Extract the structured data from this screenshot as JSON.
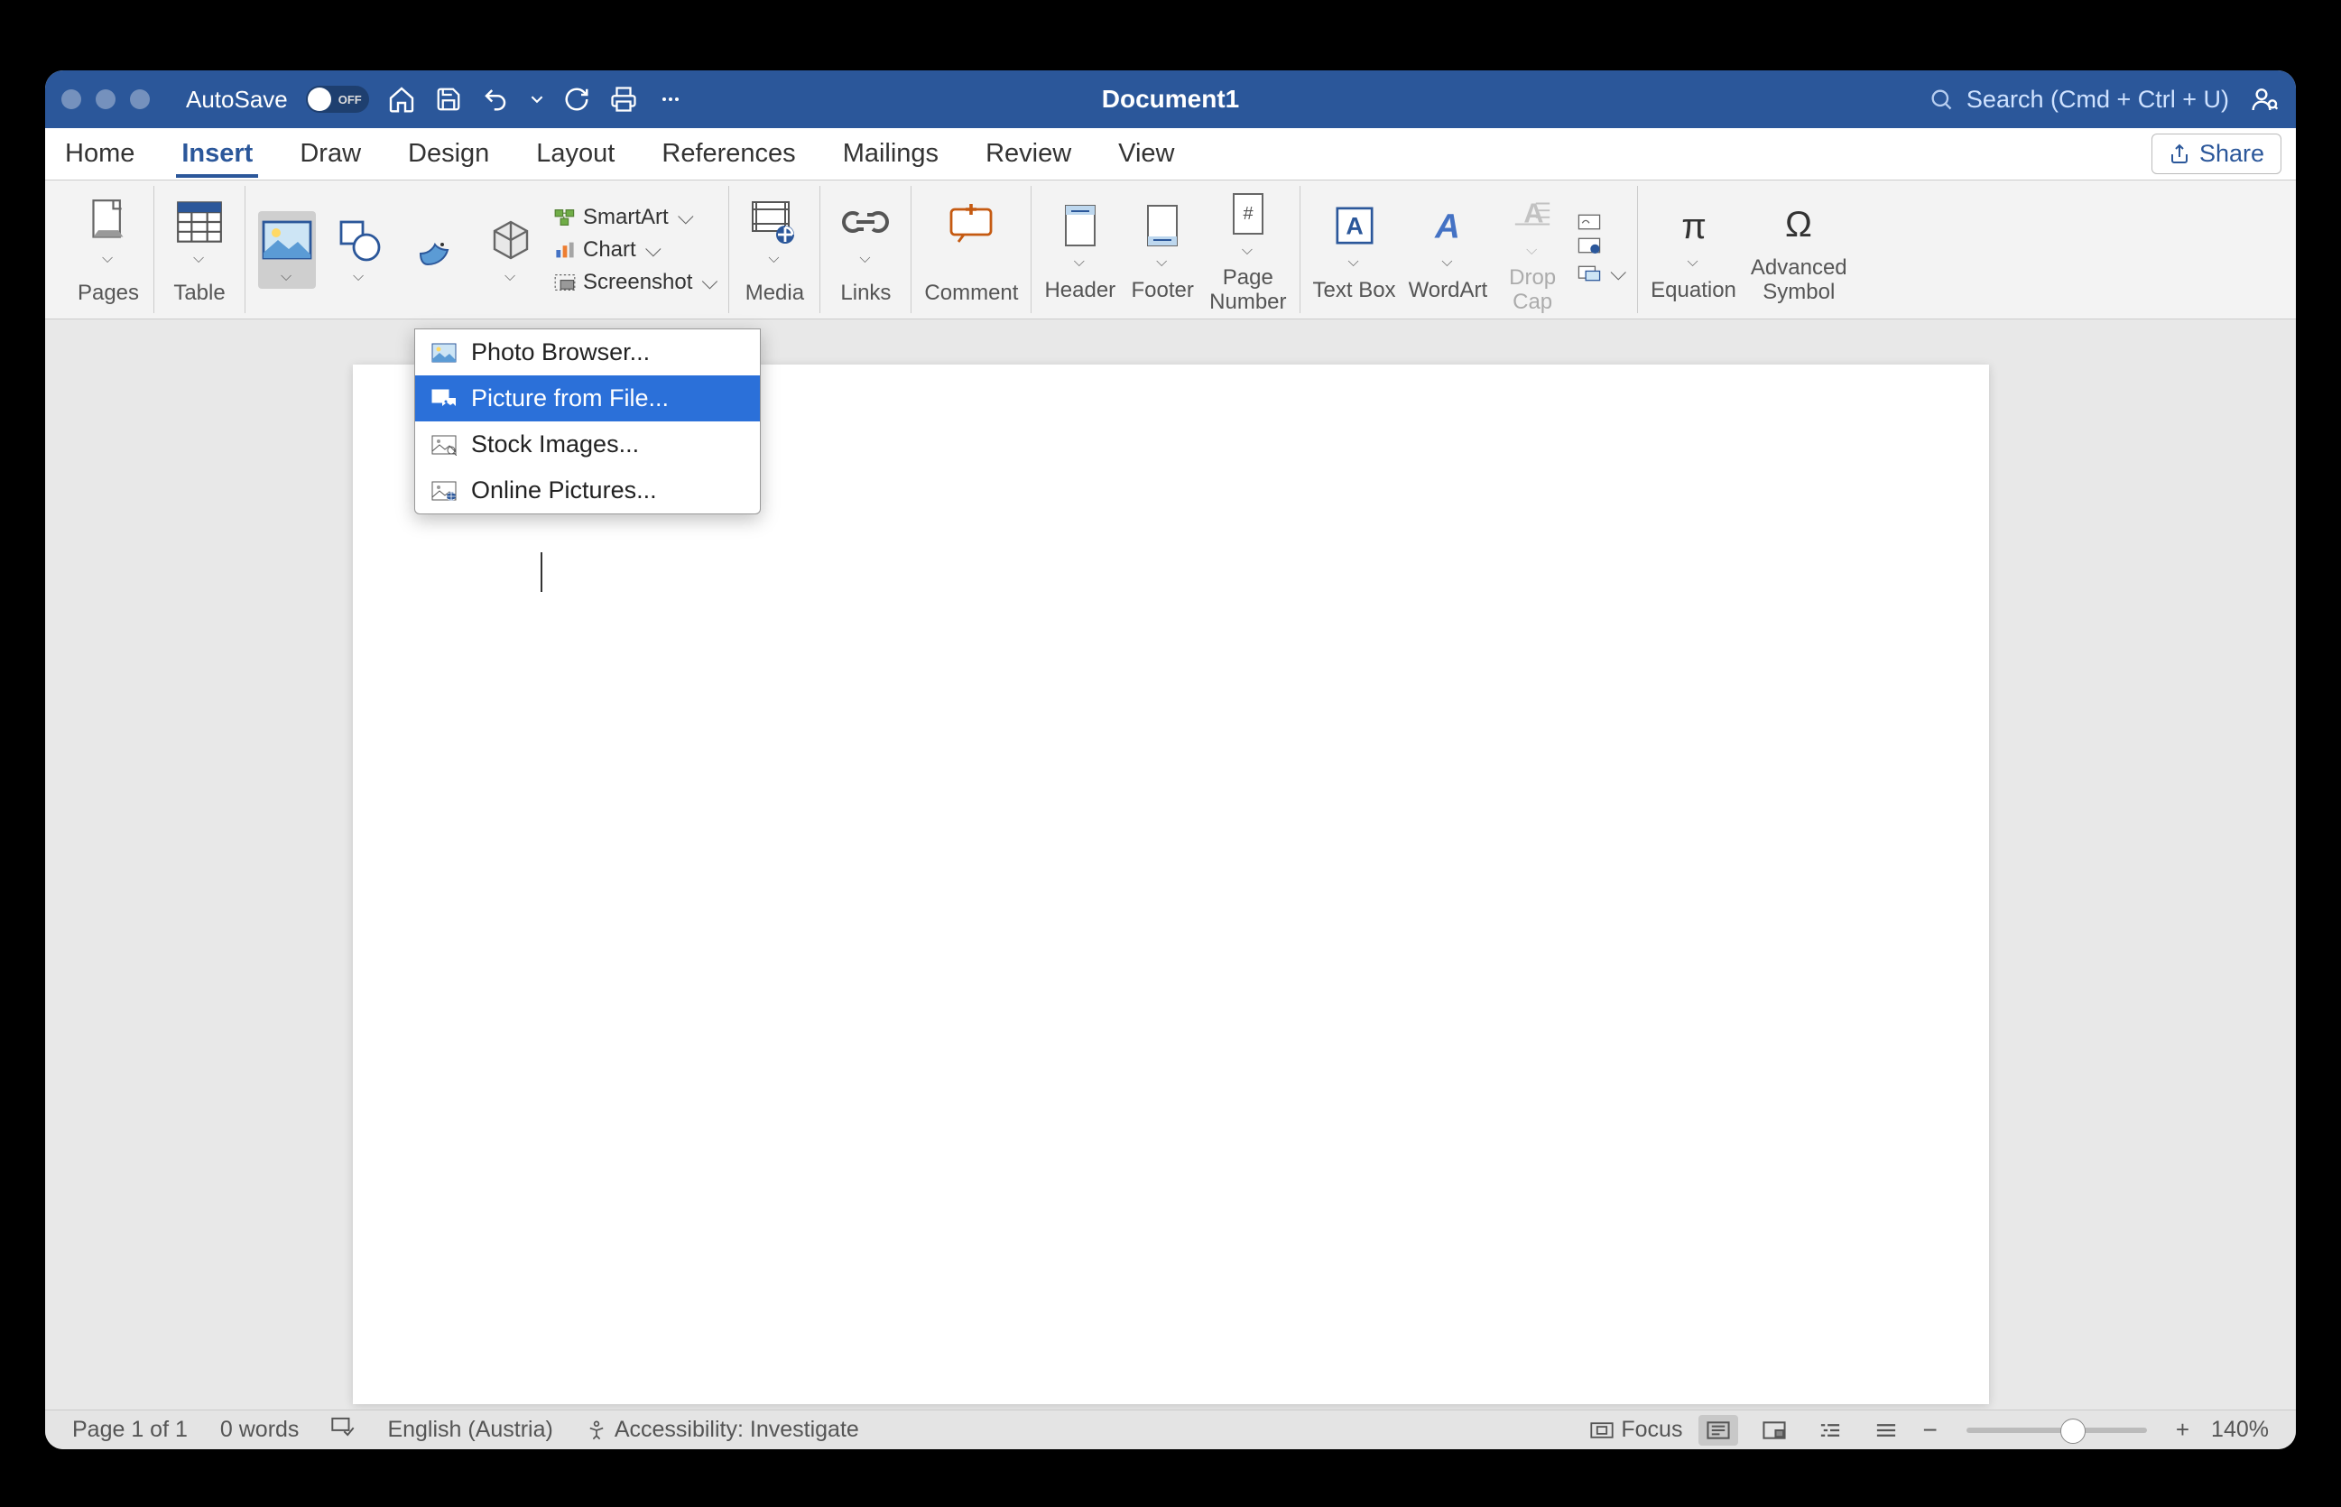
{
  "titlebar": {
    "autosave_label": "AutoSave",
    "toggle_state": "OFF",
    "doc_title": "Document1",
    "search_placeholder": "Search (Cmd + Ctrl + U)"
  },
  "tabs": {
    "items": [
      "Home",
      "Insert",
      "Draw",
      "Design",
      "Layout",
      "References",
      "Mailings",
      "Review",
      "View"
    ],
    "active_index": 1,
    "share_label": "Share"
  },
  "ribbon": {
    "pages": "Pages",
    "table": "Table",
    "smartart": "SmartArt",
    "chart": "Chart",
    "screenshot": "Screenshot",
    "media": "Media",
    "links": "Links",
    "comment": "Comment",
    "header": "Header",
    "footer": "Footer",
    "page_number": "Page\nNumber",
    "text_box": "Text Box",
    "wordart": "WordArt",
    "drop_cap": "Drop\nCap",
    "equation": "Equation",
    "advanced_symbol": "Advanced\nSymbol"
  },
  "pictures_dropdown": {
    "items": [
      {
        "label": "Photo Browser..."
      },
      {
        "label": "Picture from File..."
      },
      {
        "label": "Stock Images..."
      },
      {
        "label": "Online Pictures..."
      }
    ],
    "selected_index": 1
  },
  "statusbar": {
    "page_info": "Page 1 of 1",
    "words": "0 words",
    "language": "English (Austria)",
    "accessibility": "Accessibility: Investigate",
    "focus": "Focus",
    "zoom": "140%"
  }
}
